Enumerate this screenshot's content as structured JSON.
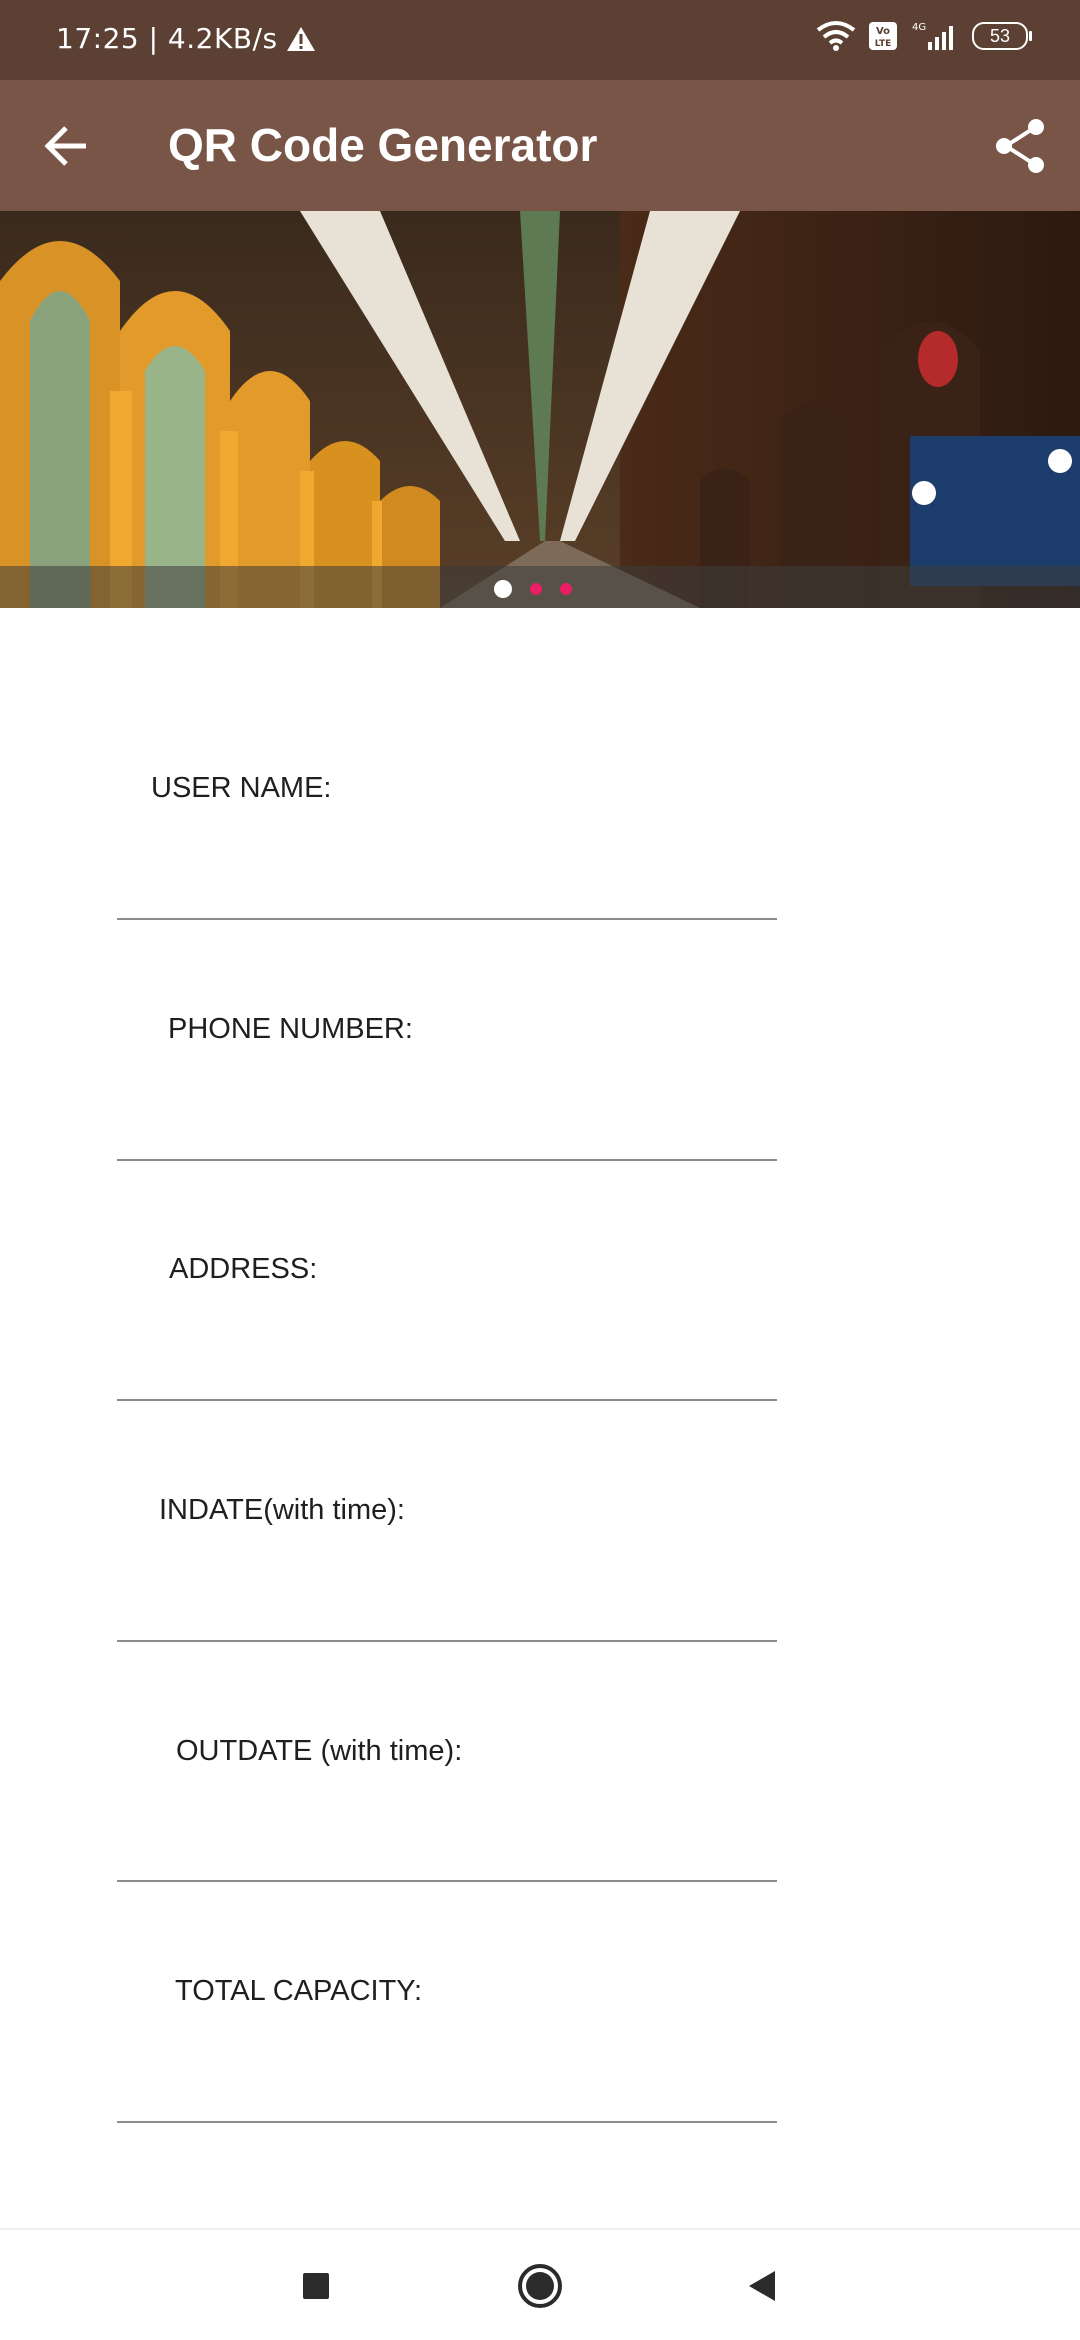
{
  "status_bar": {
    "time_speed": "17:25 | 4.2KB/s",
    "battery_level": "53",
    "network": "4G"
  },
  "app_bar": {
    "title": "QR Code Generator",
    "back_icon": "arrow-left-icon",
    "share_icon": "share-icon",
    "background": "#795548"
  },
  "banner": {
    "pages": 3,
    "active_page": 1,
    "active_dot_color": "#ffffff",
    "inactive_dot_color": "#e91e63"
  },
  "form": {
    "fields": [
      {
        "label": "USER NAME:",
        "value": ""
      },
      {
        "label": "PHONE NUMBER:",
        "value": ""
      },
      {
        "label": "ADDRESS:",
        "value": ""
      },
      {
        "label": "INDATE(with time):",
        "value": ""
      },
      {
        "label": "OUTDATE (with time):",
        "value": ""
      },
      {
        "label": "TOTAL CAPACITY:",
        "value": ""
      }
    ]
  },
  "nav_bar": {
    "recents_icon": "square-icon",
    "home_icon": "circle-icon",
    "back_icon": "triangle-back-icon"
  }
}
